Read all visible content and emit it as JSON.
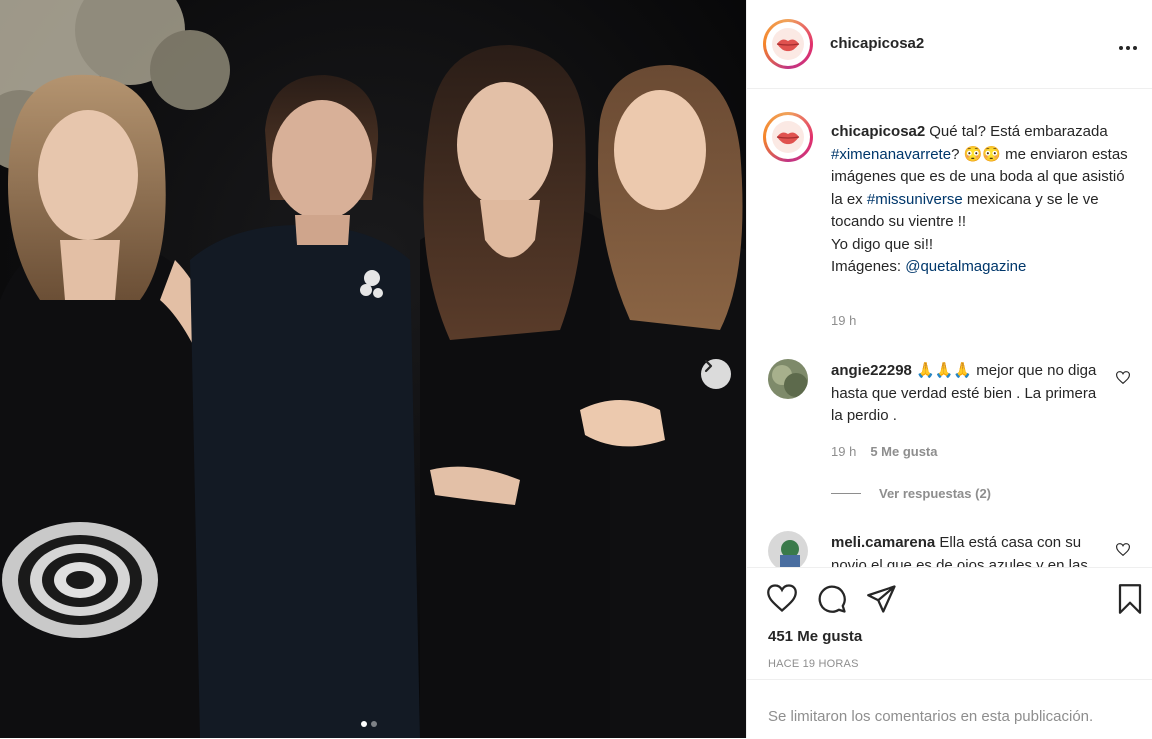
{
  "photo": {
    "carousel": {
      "current": 1,
      "total": 2
    }
  },
  "header": {
    "username": "chicapicosa2"
  },
  "caption": {
    "username": "chicapicosa2",
    "text_1": "Qué tal? Está embarazada ",
    "hashtag_1": "#ximenanavarrete",
    "text_2": "? 😳😳 me enviaron estas imágenes que es de una boda al que asistió la ex ",
    "hashtag_2": "#missuniverse",
    "text_3": " mexicana y se le ve tocando su vientre !!",
    "line_2": "Yo digo que si!!",
    "line_3_prefix": "Imágenes: ",
    "mention": "@quetalmagazine",
    "time": "19 h"
  },
  "comments": [
    {
      "username": "angie22298",
      "text": " 🙏🙏🙏 mejor que no diga hasta que verdad esté bien . La primera la perdio .",
      "time": "19 h",
      "likes": "5 Me gusta",
      "replies": "Ver respuestas (2)"
    },
    {
      "username": "meli.camarena",
      "text": " Ella está casa con su novio el que es de ojos azules y en las fotos del jardín está con él"
    }
  ],
  "actions": {
    "likes": "451 Me gusta",
    "time_ago": "HACE 19 HORAS",
    "limited_comments": "Se limitaron los comentarios en esta publicación."
  },
  "colors": {
    "link": "#00376b",
    "muted": "#8e8e8e",
    "text": "#262626",
    "border": "#efefef"
  },
  "icons": [
    "more-icon",
    "heart-icon",
    "comment-icon",
    "share-icon",
    "bookmark-icon",
    "chevron-right-icon"
  ]
}
